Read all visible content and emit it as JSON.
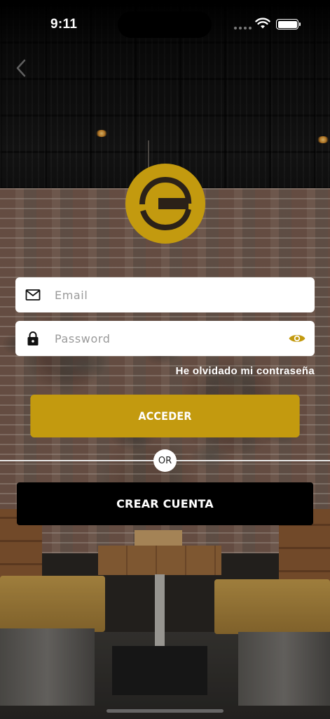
{
  "status_bar": {
    "time": "9:11"
  },
  "login_form": {
    "email_placeholder": "Email",
    "password_placeholder": "Password",
    "forgot_password": "He olvidado mi contraseña",
    "login_button": "ACCEDER",
    "divider_text": "OR",
    "create_account_button": "CREAR CUENTA"
  },
  "colors": {
    "brand_gold": "#c39a0f",
    "create_button": "#000000",
    "field_background": "#ffffff"
  },
  "icons": {
    "back": "chevron-left-icon",
    "logo": "brand-logo",
    "email": "envelope-icon",
    "password": "lock-icon",
    "reveal_password": "eye-icon"
  }
}
